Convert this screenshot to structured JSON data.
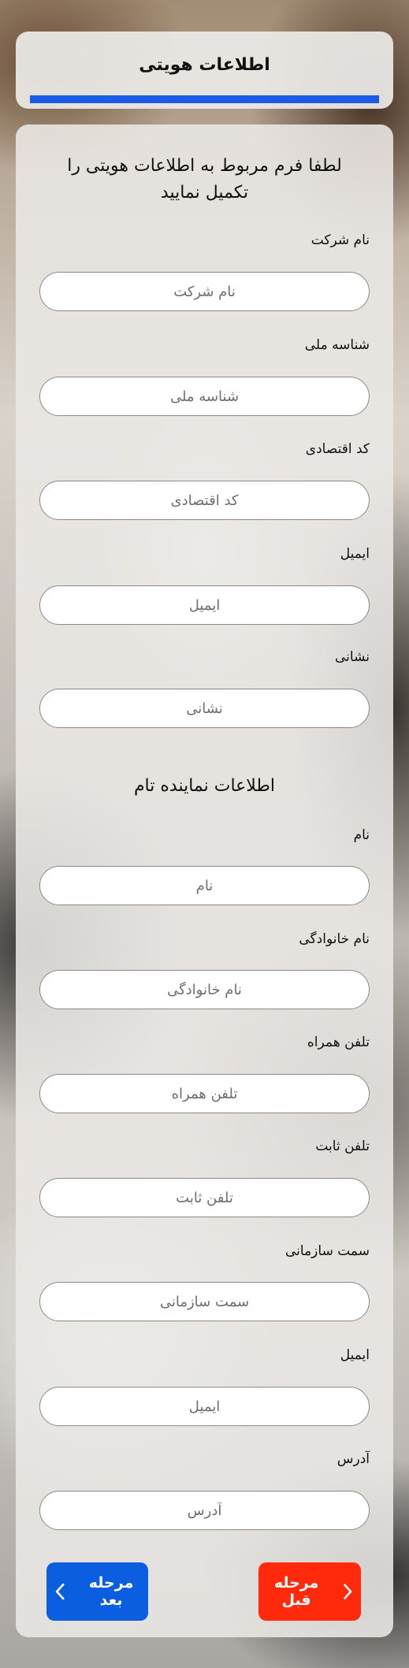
{
  "header": {
    "title": "اطلاعات هویتی",
    "progress": 1.0,
    "progress_color": "#1a5ce6"
  },
  "form": {
    "intro": "لطفا فرم مربوط به اطلاعات هویتی را تکمیل نمایید",
    "company_fields": [
      {
        "label": "نام شرکت",
        "placeholder": "نام شرکت"
      },
      {
        "label": "شناسه ملی",
        "placeholder": "شناسه ملی"
      },
      {
        "label": "کد اقتصادی",
        "placeholder": "کد اقتصادی"
      },
      {
        "label": "ایمیل",
        "placeholder": "ایمیل"
      },
      {
        "label": "نشانی",
        "placeholder": "نشانی"
      }
    ],
    "representative_title": "اطلاعات نماینده تام",
    "representative_fields": [
      {
        "label": "نام",
        "placeholder": "نام"
      },
      {
        "label": "نام خانوادگی",
        "placeholder": "نام خانوادگی"
      },
      {
        "label": "تلفن همراه",
        "placeholder": "تلفن همراه"
      },
      {
        "label": "تلفن ثابت",
        "placeholder": "تلفن ثابت"
      },
      {
        "label": "سمت سازمانی",
        "placeholder": "سمت سازمانی"
      },
      {
        "label": "ایمیل",
        "placeholder": "ایمیل"
      },
      {
        "label": "آدرس",
        "placeholder": "آدرس"
      }
    ]
  },
  "buttons": {
    "next_label": "مرحله بعد",
    "next_icon": "chevron-left-icon",
    "next_color": "#0b5ee0",
    "prev_label": "مرحله قبل",
    "prev_icon": "chevron-right-icon",
    "prev_color": "#ff2a0c"
  }
}
